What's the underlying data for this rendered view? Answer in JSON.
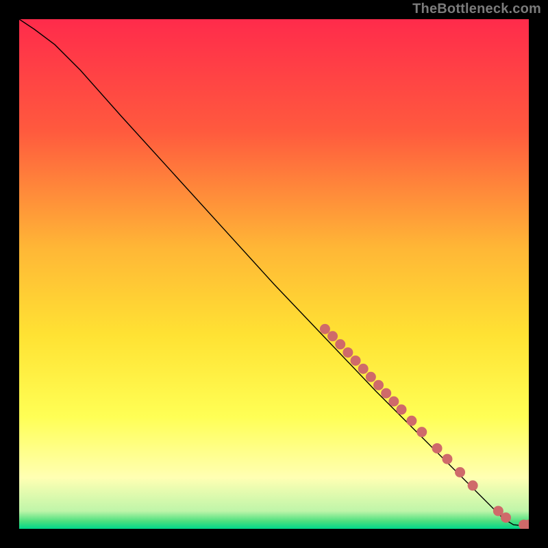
{
  "watermark": "TheBottleneck.com",
  "colors": {
    "point": "#cf6a6a",
    "line": "#000000",
    "bg_black": "#000000"
  },
  "chart_data": {
    "type": "line",
    "title": "",
    "xlabel": "",
    "ylabel": "",
    "xlim": [
      0,
      100
    ],
    "ylim": [
      0,
      100
    ],
    "grid": false,
    "gradient_stops": [
      {
        "offset": 0.0,
        "color": "#ff2b4b"
      },
      {
        "offset": 0.22,
        "color": "#ff5a3e"
      },
      {
        "offset": 0.45,
        "color": "#ffb736"
      },
      {
        "offset": 0.62,
        "color": "#ffe233"
      },
      {
        "offset": 0.78,
        "color": "#ffff55"
      },
      {
        "offset": 0.9,
        "color": "#ffffb3"
      },
      {
        "offset": 0.965,
        "color": "#bff5a9"
      },
      {
        "offset": 0.985,
        "color": "#4de07e"
      },
      {
        "offset": 1.0,
        "color": "#00d78a"
      }
    ],
    "curve": [
      {
        "x": 0,
        "y": 100
      },
      {
        "x": 3,
        "y": 98
      },
      {
        "x": 7,
        "y": 95
      },
      {
        "x": 12,
        "y": 90
      },
      {
        "x": 20,
        "y": 81
      },
      {
        "x": 30,
        "y": 70
      },
      {
        "x": 40,
        "y": 59
      },
      {
        "x": 50,
        "y": 48
      },
      {
        "x": 60,
        "y": 37.5
      },
      {
        "x": 70,
        "y": 27
      },
      {
        "x": 80,
        "y": 17
      },
      {
        "x": 87,
        "y": 10
      },
      {
        "x": 92,
        "y": 5
      },
      {
        "x": 95,
        "y": 2
      },
      {
        "x": 97,
        "y": 0.8
      },
      {
        "x": 100,
        "y": 0.5
      }
    ],
    "points": [
      {
        "x": 60,
        "y": 39.2
      },
      {
        "x": 61.5,
        "y": 37.8
      },
      {
        "x": 63,
        "y": 36.2
      },
      {
        "x": 64.5,
        "y": 34.6
      },
      {
        "x": 66,
        "y": 33.0
      },
      {
        "x": 67.5,
        "y": 31.4
      },
      {
        "x": 69,
        "y": 29.8
      },
      {
        "x": 70.5,
        "y": 28.2
      },
      {
        "x": 72,
        "y": 26.6
      },
      {
        "x": 73.5,
        "y": 25.0
      },
      {
        "x": 75,
        "y": 23.4
      },
      {
        "x": 77,
        "y": 21.2
      },
      {
        "x": 79,
        "y": 19.0
      },
      {
        "x": 82,
        "y": 15.8
      },
      {
        "x": 84,
        "y": 13.7
      },
      {
        "x": 86.5,
        "y": 11.1
      },
      {
        "x": 89,
        "y": 8.5
      },
      {
        "x": 94,
        "y": 3.5
      },
      {
        "x": 95.5,
        "y": 2.2
      },
      {
        "x": 99,
        "y": 0.8
      },
      {
        "x": 100,
        "y": 0.8
      }
    ]
  }
}
